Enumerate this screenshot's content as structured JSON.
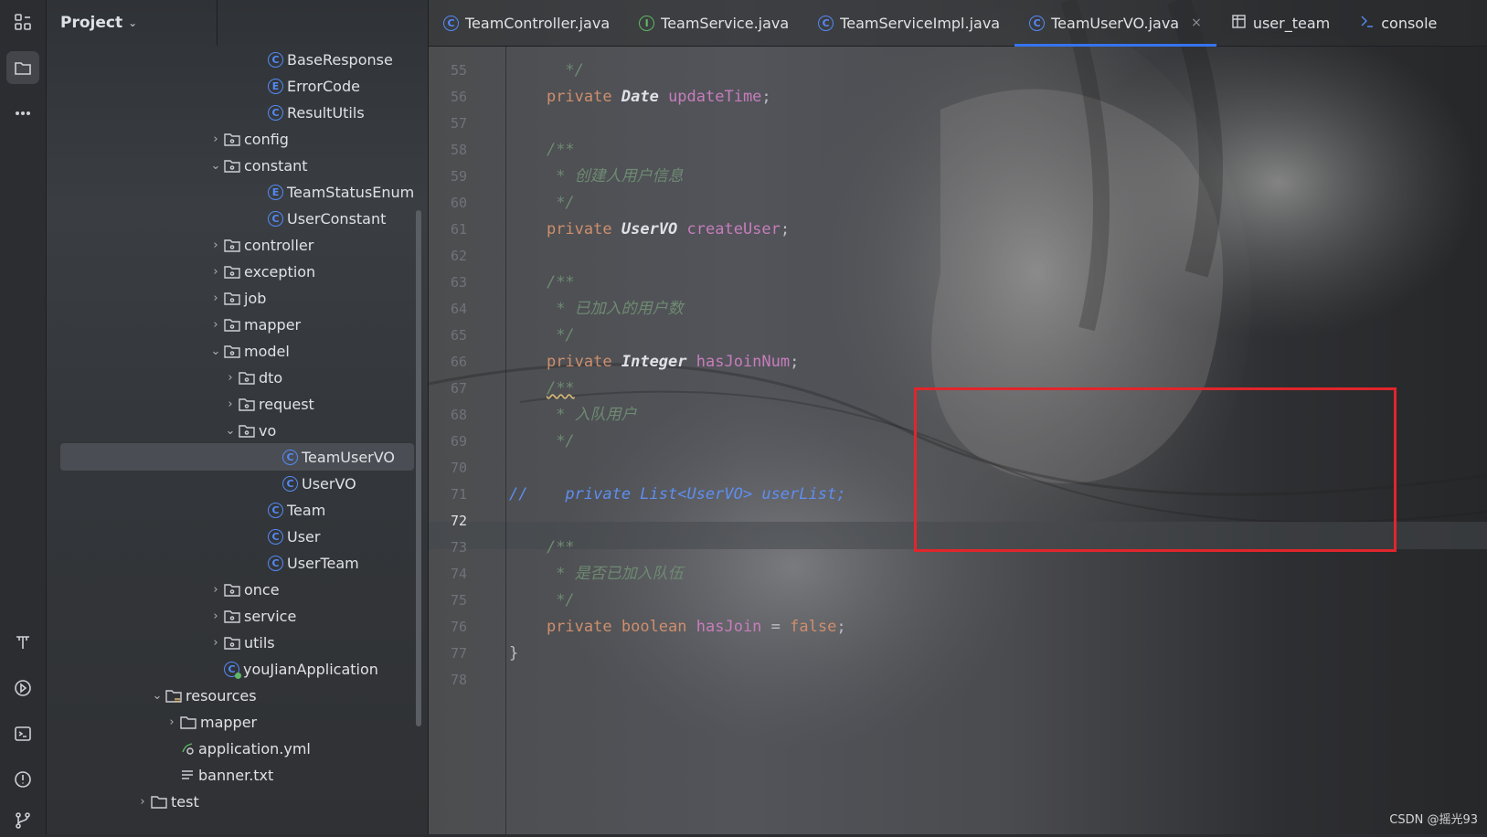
{
  "activity_bar": {
    "icons": [
      "structure-icon",
      "project-folder-icon",
      "more-icon",
      "build-icon",
      "run-icon",
      "terminal-icon",
      "problems-icon",
      "git-icon"
    ]
  },
  "project_panel": {
    "title": "Project",
    "tree": [
      {
        "label": "BaseResponse",
        "icon": "class-icon",
        "kind": "C"
      },
      {
        "label": "ErrorCode",
        "icon": "enum-icon",
        "kind": "E"
      },
      {
        "label": "ResultUtils",
        "icon": "class-icon",
        "kind": "C"
      },
      {
        "label": "config",
        "icon": "package-icon",
        "expanded": false
      },
      {
        "label": "constant",
        "icon": "package-icon",
        "expanded": true
      },
      {
        "label": "TeamStatusEnum",
        "icon": "enum-icon",
        "kind": "E"
      },
      {
        "label": "UserConstant",
        "icon": "class-icon",
        "kind": "C"
      },
      {
        "label": "controller",
        "icon": "package-icon",
        "expanded": false
      },
      {
        "label": "exception",
        "icon": "package-icon",
        "expanded": false
      },
      {
        "label": "job",
        "icon": "package-icon",
        "expanded": false
      },
      {
        "label": "mapper",
        "icon": "package-icon",
        "expanded": false
      },
      {
        "label": "model",
        "icon": "package-icon",
        "expanded": true
      },
      {
        "label": "dto",
        "icon": "package-icon",
        "expanded": false
      },
      {
        "label": "request",
        "icon": "package-icon",
        "expanded": false
      },
      {
        "label": "vo",
        "icon": "package-icon",
        "expanded": true
      },
      {
        "label": "TeamUserVO",
        "icon": "class-icon",
        "kind": "C",
        "selected": true
      },
      {
        "label": "UserVO",
        "icon": "class-icon",
        "kind": "C"
      },
      {
        "label": "Team",
        "icon": "class-icon",
        "kind": "C"
      },
      {
        "label": "User",
        "icon": "class-icon",
        "kind": "C"
      },
      {
        "label": "UserTeam",
        "icon": "class-icon",
        "kind": "C"
      },
      {
        "label": "once",
        "icon": "package-icon",
        "expanded": false
      },
      {
        "label": "service",
        "icon": "package-icon",
        "expanded": false
      },
      {
        "label": "utils",
        "icon": "package-icon",
        "expanded": false
      },
      {
        "label": "youJianApplication",
        "icon": "spring-app-icon",
        "kind": "C"
      },
      {
        "label": "resources",
        "icon": "resources-folder-icon",
        "expanded": true
      },
      {
        "label": "mapper",
        "icon": "folder-icon",
        "expanded": false
      },
      {
        "label": "application.yml",
        "icon": "yaml-icon"
      },
      {
        "label": "banner.txt",
        "icon": "text-file-icon"
      },
      {
        "label": "test",
        "icon": "folder-icon",
        "expanded": false
      }
    ]
  },
  "tabs": [
    {
      "label": "TeamController.java",
      "icon": "class-icon",
      "kind": "C"
    },
    {
      "label": "TeamService.java",
      "icon": "interface-icon",
      "kind": "I"
    },
    {
      "label": "TeamServiceImpl.java",
      "icon": "class-icon",
      "kind": "C"
    },
    {
      "label": "TeamUserVO.java",
      "icon": "class-icon",
      "kind": "C",
      "active": true,
      "close": "×"
    },
    {
      "label": "user_team",
      "icon": "table-icon"
    },
    {
      "label": "console",
      "icon": "console-icon"
    }
  ],
  "editor": {
    "line_numbers": [
      "55",
      "56",
      "57",
      "58",
      "59",
      "60",
      "61",
      "62",
      "63",
      "64",
      "65",
      "66",
      "67",
      "68",
      "69",
      "70",
      "71",
      "72",
      "73",
      "74",
      "75",
      "76",
      "77",
      "78"
    ],
    "current_line": "72",
    "code": {
      "l55": "*/",
      "l56_kw": "private",
      "l56_type": "Date",
      "l56_field": "updateTime",
      "l56_end": ";",
      "l58": "/**",
      "l59": " * 创建人用户信息",
      "l60": " */",
      "l61_kw": "private",
      "l61_type": "UserVO",
      "l61_field": "createUser",
      "l61_end": ";",
      "l63": "/**",
      "l64": " * 已加入的用户数",
      "l65": " */",
      "l66_kw": "private",
      "l66_type": "Integer",
      "l66_field": "hasJoinNum",
      "l66_end": ";",
      "l67": "/**",
      "l68": " * 入队用户",
      "l69": " */",
      "l71": "//    private List<UserVO> userList;",
      "l73": "/**",
      "l74": " * 是否已加入队伍",
      "l75": " */",
      "l76_kw": "private",
      "l76_type": "boolean",
      "l76_field": "hasJoin",
      "l76_eq": " = ",
      "l76_val": "false",
      "l76_end": ";",
      "l77": "}"
    }
  },
  "watermark": "CSDN @摇光93",
  "colors": {
    "accent": "#3574f0",
    "highlight_box": "#e0262c",
    "keyword": "#cf8e6d",
    "field": "#c77dbb",
    "class_icon": "#548af7"
  }
}
